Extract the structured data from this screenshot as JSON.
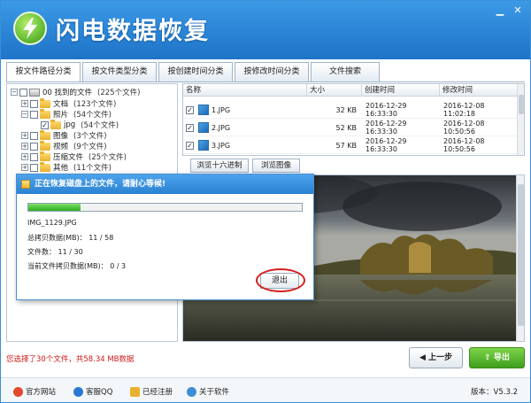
{
  "app": {
    "title": "闪电数据恢复",
    "brand_color": "#2b84d6"
  },
  "window_controls": {
    "minimize_icon": "minimize-icon",
    "close_icon": "close-icon"
  },
  "tabs": [
    {
      "label": "按文件路径分类",
      "active": true
    },
    {
      "label": "按文件类型分类",
      "active": false
    },
    {
      "label": "按创建时间分类",
      "active": false
    },
    {
      "label": "按修改时间分类",
      "active": false
    },
    {
      "label": "文件搜索",
      "active": false
    }
  ],
  "tree": {
    "root": {
      "label": "00 找到的文件",
      "count": "(225个文件)"
    },
    "items": [
      {
        "label": "文档",
        "count": "(123个文件)"
      },
      {
        "label": "照片",
        "count": "(54个文件)"
      },
      {
        "label": "jpg",
        "count": "(54个文件)"
      },
      {
        "label": "图像",
        "count": "(3个文件)"
      },
      {
        "label": "视频",
        "count": "(9个文件)"
      },
      {
        "label": "压缩文件",
        "count": "(25个文件)"
      },
      {
        "label": "其他",
        "count": "(11个文件)"
      }
    ]
  },
  "file_list": {
    "columns": [
      "名称",
      "大小",
      "创建时间",
      "修改时间"
    ],
    "rows": [
      {
        "name": "1.JPG",
        "size": "32 KB",
        "created": "2016-12-29 16:33:30",
        "modified": "2016-12-08 11:02:18",
        "checked": true
      },
      {
        "name": "2.JPG",
        "size": "52 KB",
        "created": "2016-12-29 16:33:30",
        "modified": "2016-12-08 10:50:56",
        "checked": true
      },
      {
        "name": "3.JPG",
        "size": "57 KB",
        "created": "2016-12-29 16:33:30",
        "modified": "2016-12-08 10:50:56",
        "checked": true
      }
    ]
  },
  "view_buttons": {
    "hex": "浏览十六进制",
    "image": "浏览图像"
  },
  "dialog": {
    "title": "正在恢复磁盘上的文件，请耐心等候!",
    "progress": 0.19,
    "current_file": "IMG_1129.JPG",
    "copied_label": "总拷贝数据(MB)：",
    "copied_value": "11 / 58",
    "files_label": "文件数：",
    "files_value": "11 / 30",
    "current_label": "当前文件拷贝数据(MB)：",
    "current_value": "0 / 3",
    "exit_label": "退出"
  },
  "status_message": "您选择了30个文件，共58.34 MB数据",
  "buttons": {
    "prev": "上一步",
    "export": "导出"
  },
  "footer": {
    "links": [
      "官方网站",
      "客服QQ",
      "已经注册",
      "关于软件"
    ],
    "version_label": "版本：",
    "version": "V5.3.2"
  }
}
